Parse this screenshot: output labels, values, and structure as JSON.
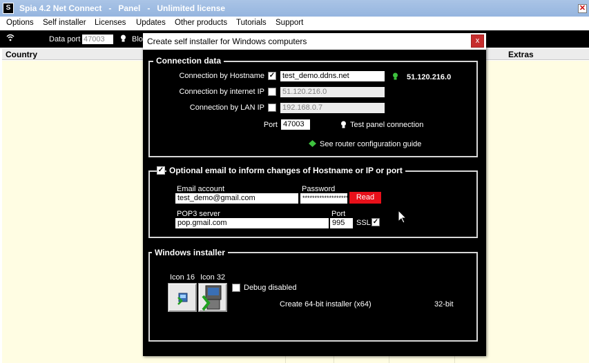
{
  "window": {
    "app_icon": "S",
    "title": "Spia 4.2 Net Connect   -   Panel   -   Unlimited license",
    "close_glyph": "✕"
  },
  "menu": [
    "Options",
    "Self installer",
    "Licenses",
    "Updates",
    "Other products",
    "Tutorials",
    "Support"
  ],
  "toolbar": {
    "wifi_icon": "wifi-icon",
    "dataport_label": "Data port",
    "dataport_value": "47003",
    "blo_label": "Blo"
  },
  "table": {
    "col_country": "Country",
    "col_extras": "Extras"
  },
  "dialog": {
    "title": "Create self installer for Windows computers",
    "close_glyph": "x",
    "connection": {
      "group_title": "Connection data",
      "hostname_label": "Connection by Hostname",
      "hostname_checked": "✓",
      "hostname_value": "test_demo.ddns.net",
      "ip_display": "51.120.216.0",
      "internet_ip_label": "Connection by internet IP",
      "internet_ip_value": "51.120.216.0",
      "lan_ip_label": "Connection by LAN IP",
      "lan_ip_value": "192.168.0.7",
      "port_label": "Port",
      "port_value": "47003",
      "test_panel_label": "Test panel connection",
      "router_guide_label": "See router configuration guide"
    },
    "email": {
      "group_title": "Optional email to inform changes of Hostname or IP or port",
      "enabled_glyph": "✓",
      "account_label": "Email account",
      "account_value": "test_demo@gmail.com",
      "password_label": "Password",
      "password_value": "********************",
      "read_button": "Read",
      "pop3_label": "POP3 server",
      "pop3_value": "pop.gmail.com",
      "port_label": "Port",
      "port_value": "995",
      "ssl_label": "SSL",
      "ssl_glyph": "✓"
    },
    "installer": {
      "group_title": "Windows installer",
      "icon16_label": "Icon 16",
      "icon32_label": "Icon 32",
      "debug_label": "Debug disabled",
      "create64_label": "Create 64-bit installer  (x64)",
      "bit32_label": "32-bit"
    }
  },
  "colors": {
    "accent_green": "#3ec23e",
    "read_button": "#e8101a",
    "close_red": "#c62d2d"
  }
}
